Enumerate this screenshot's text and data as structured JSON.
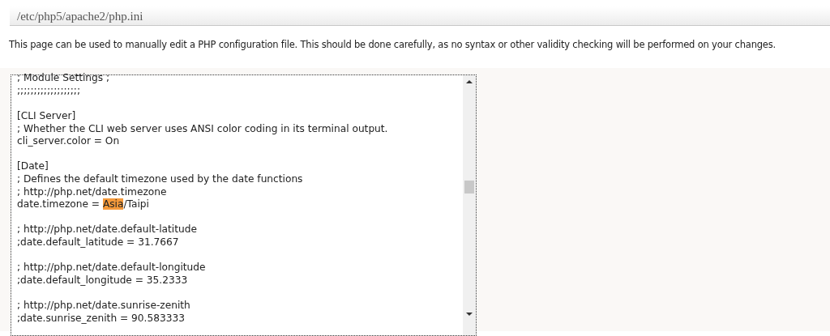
{
  "header": {
    "title": "/etc/php5/apache2/php.ini"
  },
  "description": "This page can be used to manually edit a PHP configuration file. This should be done carefully, as no syntax or other validity checking will be performed on your changes.",
  "editor": {
    "blocks": [
      {
        "lines": [
          [
            {
              "text": "; Module Settings ;",
              "selected": false
            }
          ],
          [
            {
              "text": ";;;;;;;;;;;;;;;;;;;",
              "selected": false
            }
          ]
        ]
      },
      {
        "lines": [
          [
            {
              "text": "[CLI Server]",
              "selected": false
            }
          ],
          [
            {
              "text": "; Whether the CLI web server uses ANSI color coding in its terminal output.",
              "selected": false
            }
          ],
          [
            {
              "text": "cli_server.color = On",
              "selected": false
            }
          ]
        ]
      },
      {
        "lines": [
          [
            {
              "text": "[Date]",
              "selected": false
            }
          ],
          [
            {
              "text": "; Defines the default timezone used by the date functions",
              "selected": false
            }
          ],
          [
            {
              "text": "; http://php.net/date.timezone",
              "selected": false
            }
          ],
          [
            {
              "text": "date.timezone = ",
              "selected": false
            },
            {
              "text": "Asia",
              "selected": true
            },
            {
              "text": "/Taipi",
              "selected": false
            }
          ]
        ]
      },
      {
        "lines": [
          [
            {
              "text": "; http://php.net/date.default-latitude",
              "selected": false
            }
          ],
          [
            {
              "text": ";date.default_latitude = 31.7667",
              "selected": false
            }
          ]
        ]
      },
      {
        "lines": [
          [
            {
              "text": "; http://php.net/date.default-longitude",
              "selected": false
            }
          ],
          [
            {
              "text": ";date.default_longitude = 35.2333",
              "selected": false
            }
          ]
        ]
      },
      {
        "lines": [
          [
            {
              "text": "; http://php.net/date.sunrise-zenith",
              "selected": false
            }
          ],
          [
            {
              "text": ";date.sunrise_zenith = 90.583333",
              "selected": false
            }
          ]
        ]
      }
    ]
  }
}
